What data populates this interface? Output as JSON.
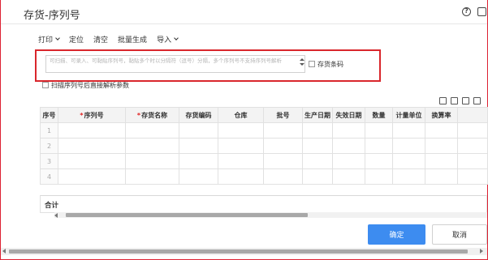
{
  "window": {
    "title": "存货-序列号"
  },
  "toolbar": {
    "print": "打印",
    "locate": "定位",
    "clear": "清空",
    "batch_generate": "批量生成",
    "import": "导入"
  },
  "input": {
    "placeholder": "可扫描、可录入、可黏贴序列号，黏贴多个时以分隔符（逗号）分隔，多个序列号不支持序列号解析"
  },
  "options": {
    "inventory_barcode": "存货条码",
    "scan_parse": "扫描序列号后直接解析参数"
  },
  "table": {
    "headers": [
      "序号",
      "序列号",
      "存货名称",
      "存货编码",
      "仓库",
      "批号",
      "生产日期",
      "失效日期",
      "数量",
      "计量单位",
      "换算率"
    ],
    "rows": [
      "1",
      "2",
      "3",
      "4"
    ],
    "total_label": "合计"
  },
  "buttons": {
    "ok": "确定",
    "cancel": "取消"
  },
  "colors": {
    "primary": "#3d8cf0",
    "highlight_box": "#d9262c",
    "required": "#e02020"
  }
}
